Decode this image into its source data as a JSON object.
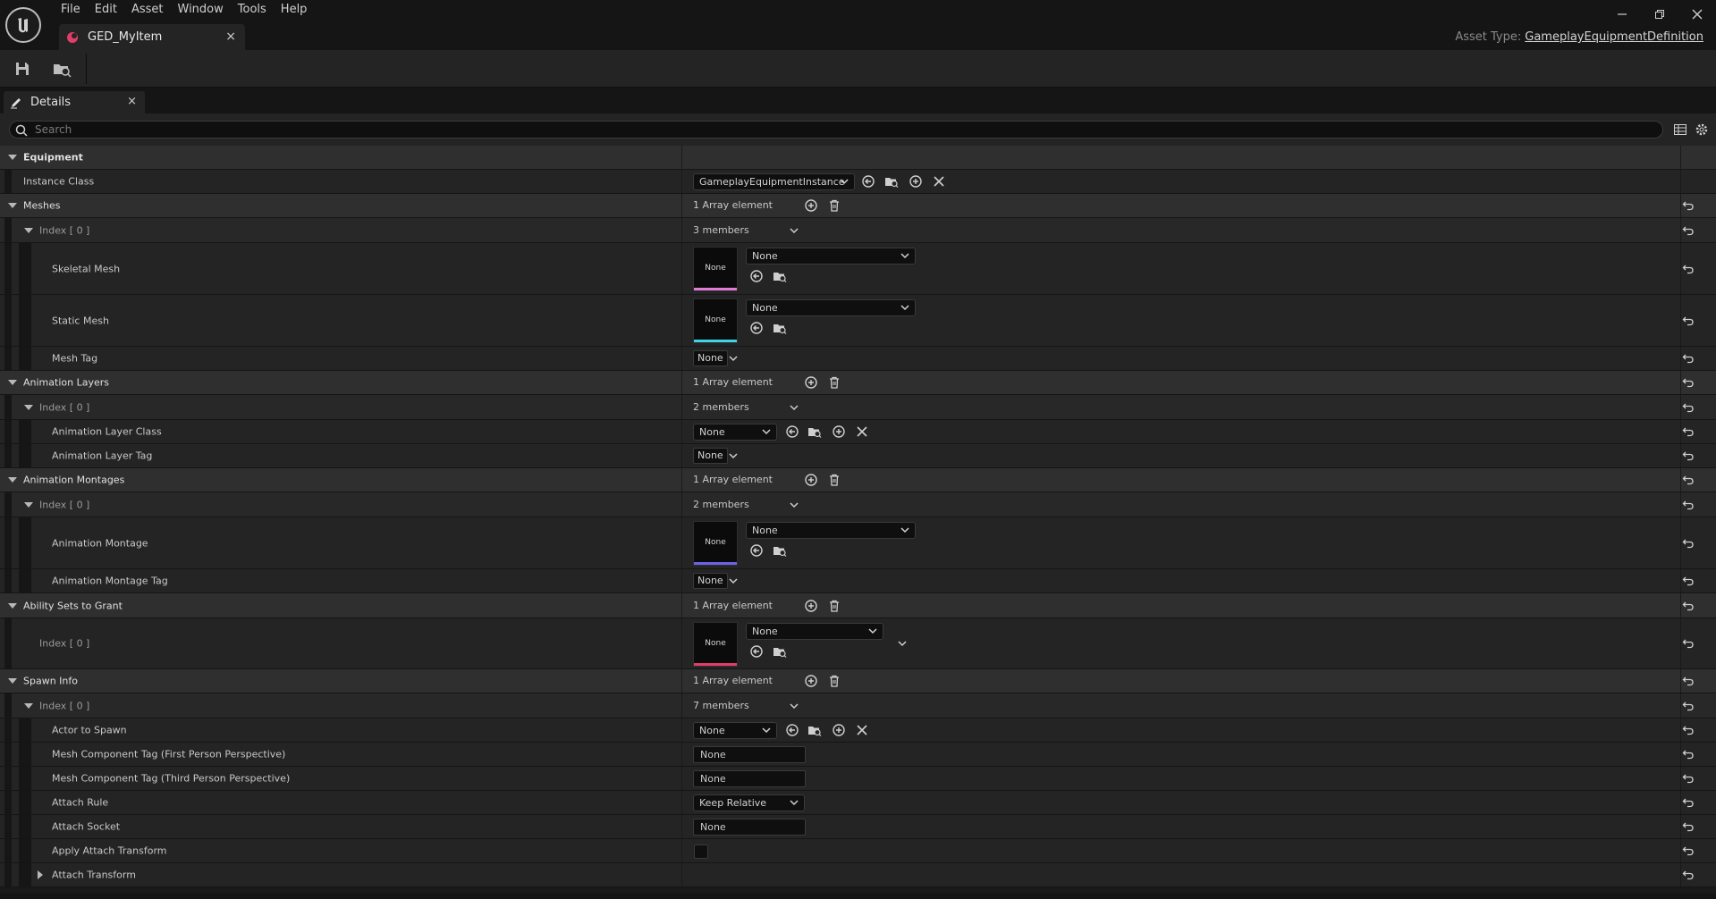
{
  "menu": [
    "File",
    "Edit",
    "Asset",
    "Window",
    "Tools",
    "Help"
  ],
  "document_tab": {
    "label": "GED_MyItem",
    "close": "×",
    "accent": "#e23c6a"
  },
  "asset_type": {
    "label": "Asset Type:",
    "value": "GameplayEquipmentDefinition"
  },
  "details_tab": {
    "label": "Details",
    "close": "×"
  },
  "search": {
    "placeholder": "Search"
  },
  "rows": {
    "equipment": "Equipment",
    "instance_class": {
      "label": "Instance Class",
      "value": "GameplayEquipmentInstance"
    },
    "meshes": {
      "label": "Meshes",
      "value": "1 Array element"
    },
    "meshes_index": {
      "label": "Index [ 0 ]",
      "value": "3 members"
    },
    "skeletal_mesh": {
      "label": "Skeletal Mesh",
      "thumb": "None",
      "value": "None",
      "accent": "#e07bd6"
    },
    "static_mesh": {
      "label": "Static Mesh",
      "thumb": "None",
      "value": "None",
      "accent": "#3ed3e8"
    },
    "mesh_tag": {
      "label": "Mesh Tag",
      "value": "None"
    },
    "animation_layers": {
      "label": "Animation Layers",
      "value": "1 Array element"
    },
    "anim_layers_index": {
      "label": "Index [ 0 ]",
      "value": "2 members"
    },
    "animation_layer_class": {
      "label": "Animation Layer Class",
      "value": "None"
    },
    "animation_layer_tag": {
      "label": "Animation Layer Tag",
      "value": "None"
    },
    "animation_montages": {
      "label": "Animation Montages",
      "value": "1 Array element"
    },
    "anim_montages_index": {
      "label": "Index [ 0 ]",
      "value": "2 members"
    },
    "animation_montage": {
      "label": "Animation Montage",
      "thumb": "None",
      "value": "None",
      "accent": "#6c63e8"
    },
    "animation_montage_tag": {
      "label": "Animation Montage Tag",
      "value": "None"
    },
    "ability_sets": {
      "label": "Ability Sets to Grant",
      "value": "1 Array element"
    },
    "ability_sets_index": {
      "label": "Index [ 0 ]",
      "thumb": "None",
      "value": "None",
      "accent": "#e23c6a"
    },
    "spawn_info": {
      "label": "Spawn Info",
      "value": "1 Array element"
    },
    "spawn_info_index": {
      "label": "Index [ 0 ]",
      "value": "7 members"
    },
    "actor_to_spawn": {
      "label": "Actor to Spawn",
      "value": "None"
    },
    "mesh_tag_fp": {
      "label": "Mesh Component Tag (First Person Perspective)",
      "value": "None"
    },
    "mesh_tag_tp": {
      "label": "Mesh Component Tag (Third Person Perspective)",
      "value": "None"
    },
    "attach_rule": {
      "label": "Attach Rule",
      "value": "Keep Relative"
    },
    "attach_socket": {
      "label": "Attach Socket",
      "value": "None"
    },
    "apply_attach_transform": {
      "label": "Apply Attach Transform",
      "checked": false
    },
    "attach_transform": {
      "label": "Attach Transform"
    }
  }
}
